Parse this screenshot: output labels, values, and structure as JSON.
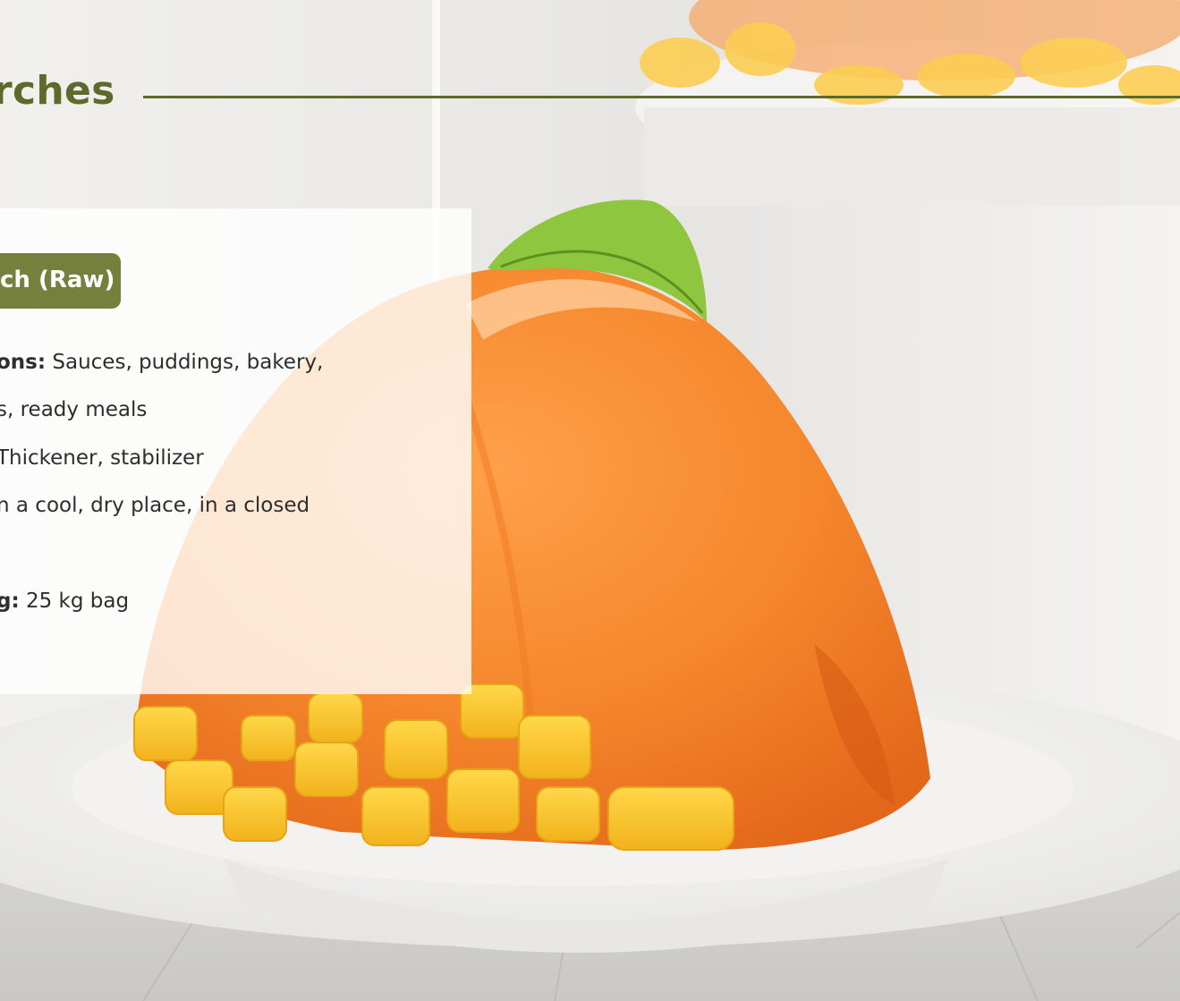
{
  "page": {
    "title": "rches",
    "accent_color": "#5c6a2c",
    "badge_color": "#74803b",
    "badge_shadow_color": "#f1ad14"
  },
  "card": {
    "badge_label": "ch (Raw)",
    "specs": [
      {
        "label": "ons:",
        "value": " Sauces, puddings, bakery,"
      },
      {
        "label": "",
        "value": "s, ready meals"
      },
      {
        "label": "",
        "value": "Thickener, stabilizer"
      },
      {
        "label": "",
        "value": "n a cool, dry place, in a closed"
      },
      {
        "label": "g:",
        "value": " 25 kg bag"
      }
    ]
  }
}
